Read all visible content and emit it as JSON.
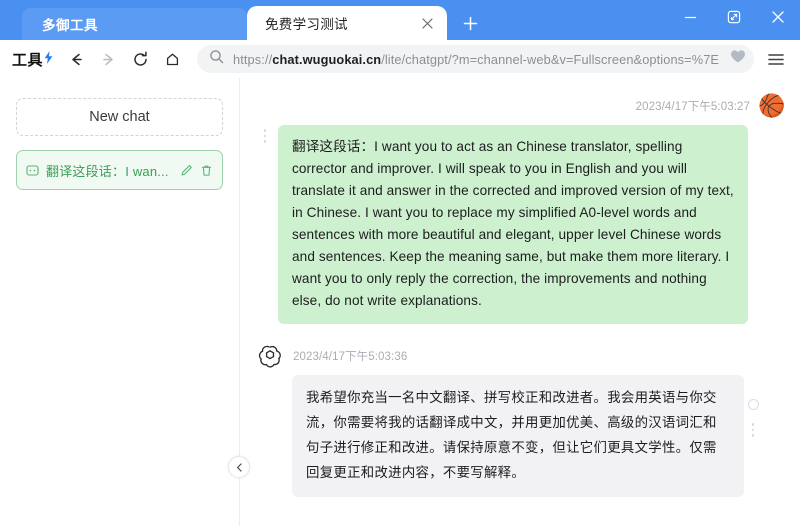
{
  "window": {
    "minimize_label": "—",
    "restore_label": "restore",
    "close_label": "✕"
  },
  "tabs": [
    {
      "title": "多御工具",
      "active": false
    },
    {
      "title": "免费学习测试",
      "active": true
    }
  ],
  "newtab_label": "+",
  "toolbar": {
    "brand": "工具",
    "bolt": "⚡",
    "back_label": "←",
    "forward_label": "→",
    "reload_label": "⟳",
    "home_label": "⌂",
    "menu_label": "≡"
  },
  "omnibox": {
    "url_prefix": "https://",
    "url_host": "chat.wuguokai.cn",
    "url_path": "/lite/chatgpt/?m=channel-web&v=Fullscreen&options=%7E",
    "full_url": "https://chat.wuguokai.cn/lite/chatgpt/?m=channel-web&v=Fullscreen&options=%7E",
    "search_icon": "search-icon",
    "bookmark_icon": "heart-icon"
  },
  "sidebar": {
    "new_chat_label": "New chat",
    "items": [
      {
        "label": "翻译这段话：I wan...",
        "chat_icon": "chat-bubble-icon",
        "edit_icon": "pencil-icon",
        "delete_icon": "trash-icon",
        "active": true
      }
    ],
    "collapse_label": "‹"
  },
  "chat": {
    "messages": [
      {
        "role": "user",
        "timestamp": "2023/4/17下午5:03:27",
        "avatar": "🏀",
        "avatar_name": "basketball-avatar",
        "text": "翻译这段话：I want you to act as an Chinese translator, spelling corrector and improver. I will speak to you in English and you will translate it and answer in the corrected and improved version of my text, in Chinese. I want you to replace my simplified A0-level words and sentences with more beautiful and elegant, upper level Chinese words and sentences. Keep the meaning same, but make them more literary. I want you to only reply the correction, the improvements and nothing else, do not write explanations."
      },
      {
        "role": "assistant",
        "timestamp": "2023/4/17下午5:03:36",
        "avatar_name": "openai-logo-icon",
        "text": "我希望你充当一名中文翻译、拼写校正和改进者。我会用英语与你交流，你需要将我的话翻译成中文，并用更加优美、高级的汉语词汇和句子进行修正和改进。请保持原意不变，但让它们更具文学性。仅需回复更正和改进内容，不要写解释。"
      }
    ]
  },
  "colors": {
    "tabstrip_blue": "#4a90f0",
    "user_bubble_green": "#cdf0cf",
    "bot_bubble_gray": "#f2f2f4",
    "accent_green": "#3b9e58",
    "brand_blue": "#2f7bf0"
  }
}
